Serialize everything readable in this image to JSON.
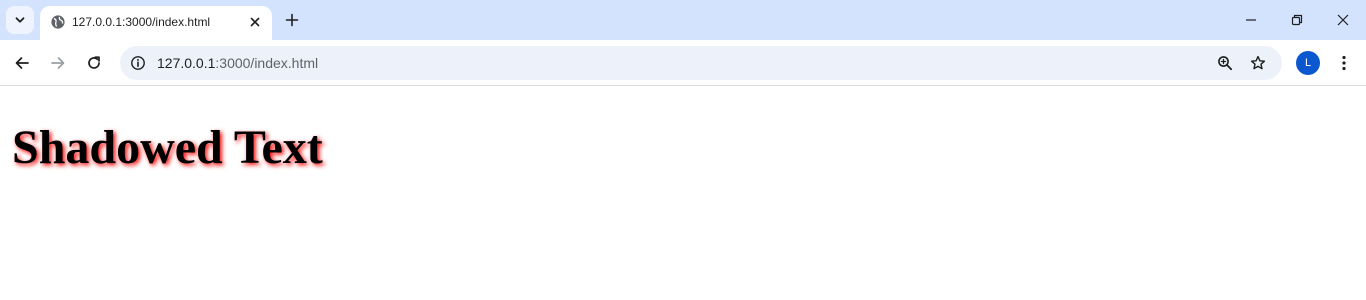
{
  "browser": {
    "tab": {
      "title": "127.0.0.1:3000/index.html",
      "favicon": "globe-icon"
    },
    "address_bar": {
      "host": "127.0.0.1",
      "path": ":3000/index.html"
    },
    "profile": {
      "initial": "L",
      "color": "#0b57d0"
    },
    "colors": {
      "tabstrip": "#d3e3fd",
      "omnibox": "#edf2fa"
    }
  },
  "page": {
    "heading": "Shadowed Text",
    "heading_color": "#000000",
    "shadow_color": "#ff0000"
  }
}
